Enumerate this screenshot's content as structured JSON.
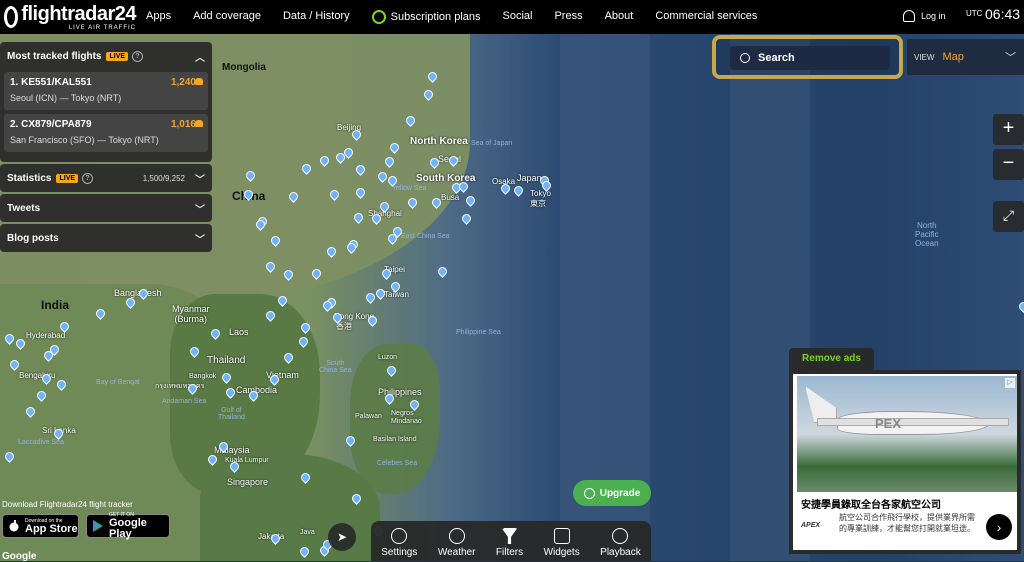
{
  "header": {
    "brand": "flightradar24",
    "tagline": "LIVE AIR TRAFFIC",
    "nav": [
      "Apps",
      "Add coverage",
      "Data / History",
      "Subscription plans",
      "Social",
      "Press",
      "About",
      "Commercial services"
    ],
    "login": "Log in",
    "utc_label": "UTC",
    "time": "06:43"
  },
  "panel": {
    "most_tracked": {
      "title": "Most tracked flights",
      "live": "LIVE",
      "flights": [
        {
          "name": "1. KE551/KAL551",
          "route": "Seoul (ICN) — Tokyo (NRT)",
          "count": "1,240"
        },
        {
          "name": "2. CX879/CPA879",
          "route": "San Francisco (SFO) — Tokyo (NRT)",
          "count": "1,016"
        }
      ]
    },
    "statistics": {
      "title": "Statistics",
      "live": "LIVE",
      "value": "1,500/9,252"
    },
    "tweets": {
      "title": "Tweets"
    },
    "blog": {
      "title": "Blog posts"
    }
  },
  "search": {
    "placeholder": "Search"
  },
  "view": {
    "label": "VIEW",
    "value": "Map"
  },
  "controls": {
    "zoom_in": "+",
    "zoom_out": "−"
  },
  "download": {
    "text": "Download Flightradar24 flight tracker",
    "appstore_l1": "Download on the",
    "appstore_l2": "App Store",
    "google_l1": "GET IT ON",
    "google_l2": "Google Play"
  },
  "toolbar": [
    "Settings",
    "Weather",
    "Filters",
    "Widgets",
    "Playback"
  ],
  "upgrade": "Upgrade",
  "ad": {
    "remove": "Remove ads",
    "title": "安捷學員錄取全台各家航空公司",
    "desc": "航空公司合作飛行學校，提供業界所需的專業訓練，才能幫您打開就業坦途。",
    "logo": "APEX",
    "tail_text": "PEX"
  },
  "map_labels": {
    "mongolia": "Mongolia",
    "china": "China",
    "north_korea": "North Korea",
    "south_korea": "South Korea",
    "seoul": "Seoul",
    "busan": "Busan",
    "tokyo": "Tokyo",
    "tokyo_jp": "東京",
    "japan": "Japan",
    "osaka": "Osaka",
    "shanghai": "Shanghai",
    "taipei": "Taipei",
    "taiwan": "Taiwan",
    "hong_kong": "Hong Kong",
    "hong_kong_zh": "香港",
    "india": "India",
    "bangladesh": "Bangladesh",
    "myanmar": "Myanmar\n(Burma)",
    "laos": "Laos",
    "thailand": "Thailand",
    "bangkok": "Bangkok",
    "bangkok_th": "กรุงเทพมหานคร",
    "vietnam": "Vietnam",
    "cambodia": "Cambodia",
    "philippines": "Philippines",
    "malaysia": "Malaysia",
    "singapore": "Singapore",
    "sri_lanka": "Sri Lanka",
    "hyderabad": "Hyderabad",
    "bengaluru": "Bengaluru",
    "jakarta": "Jakarta",
    "java": "Java",
    "beijing": "Beijing",
    "sea_of_japan": "Sea of Japan",
    "yellow_sea": "Yellow Sea",
    "east_china_sea": "East China Sea",
    "philippine_sea": "Philippine Sea",
    "south_china_sea": "South\nChina Sea",
    "bay_of_bengal": "Bay of Bengal",
    "andaman_sea": "Andaman Sea",
    "gulf_of_thailand": "Gulf of\nThailand",
    "celebes_sea": "Celebes Sea",
    "laccadive_sea": "Laccadive Sea",
    "north_pacific": "North\nPacific\nOcean",
    "luzon": "Luzon",
    "palawan": "Palawan",
    "negros": "Negros",
    "mindanao": "Mindanao",
    "basilan": "Basilan Island",
    "kuala_lumpur": "Kuala Lumpur",
    "busa": "Busa",
    "google": "Google"
  },
  "colors": {
    "accent": "#f5a623",
    "upgrade": "#4caf50",
    "highlight": "#c8a84a"
  }
}
